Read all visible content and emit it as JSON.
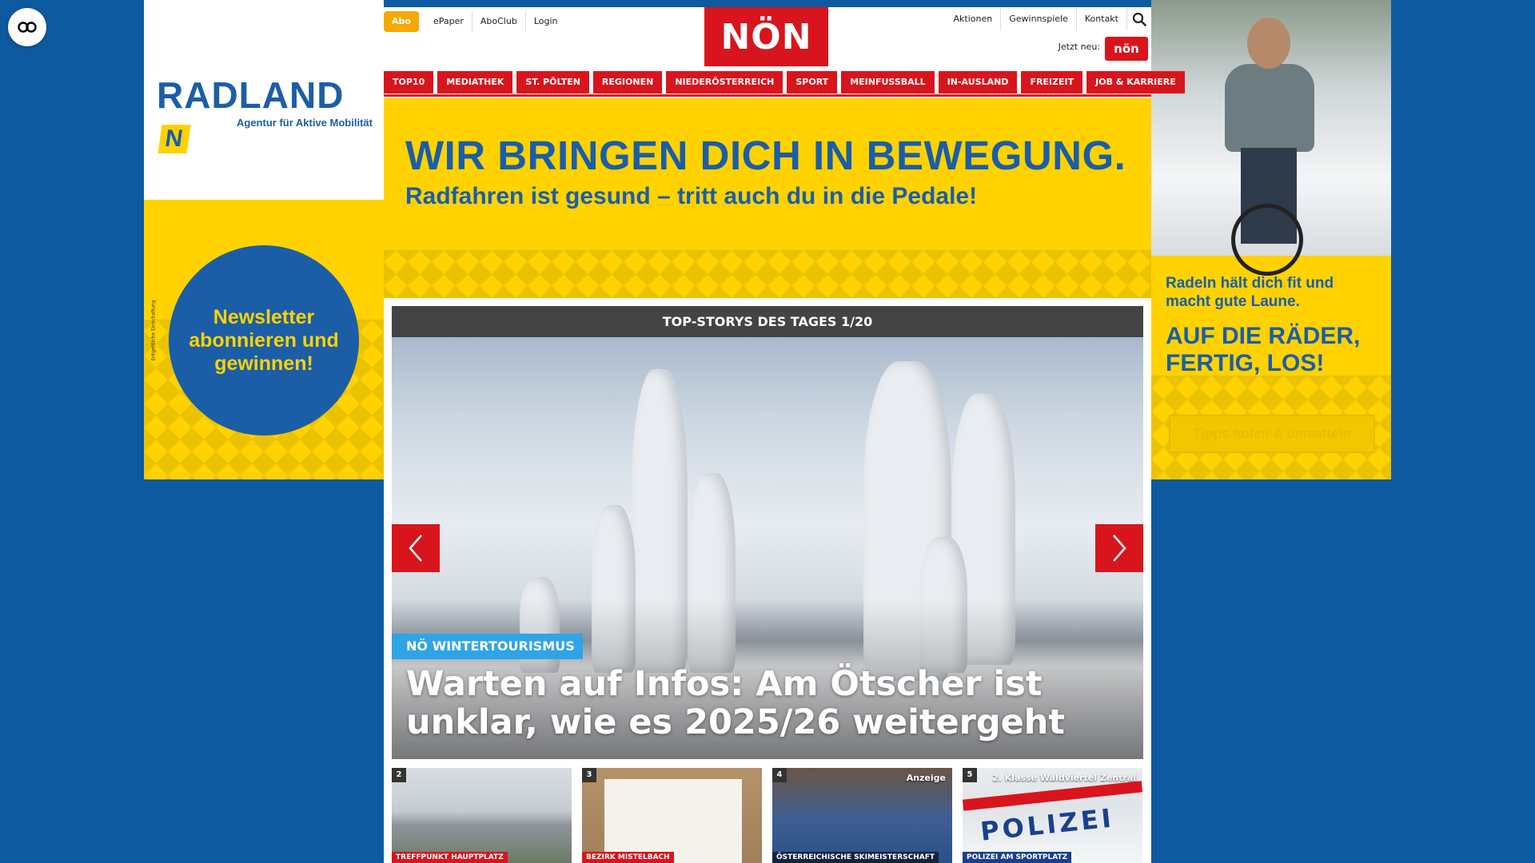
{
  "left_ad": {
    "logo_main": "RADLAND",
    "logo_n": "N",
    "logo_sub": "Agentur für Aktive Mobilität",
    "newsletter": "Newsletter abonnieren und gewinnen!",
    "vertical_note": "Entgeltliche Einschaltung"
  },
  "right_ad": {
    "text_small": "Radeln hält dich fit und macht gute Laune.",
    "text_big": "AUF DIE RÄDER, FERTIG, LOS!",
    "button": "Tipps holen & umsatteln"
  },
  "header": {
    "abo": "Abo",
    "util_left": [
      "ePaper",
      "AboClub",
      "Login"
    ],
    "logo": "NÖN",
    "util_right": [
      "Aktionen",
      "Gewinnspiele",
      "Kontakt"
    ],
    "jetzt_neu": "Jetzt neu:",
    "mini_logo": "nön"
  },
  "nav": [
    "TOP10",
    "MEDIATHEK",
    "ST. PÖLTEN",
    "REGIONEN",
    "NIEDERÖSTERREICH",
    "SPORT",
    "MEINFUSSBALL",
    "IN-AUSLAND",
    "FREIZEIT",
    "JOB & KARRIERE"
  ],
  "banner": {
    "headline": "WIR BRINGEN DICH IN BEWEGUNG.",
    "subline": "Radfahren ist gesund – tritt auch du in die Pedale!"
  },
  "top_stories": {
    "header": "TOP-STORYS DES TAGES 1/20",
    "kicker": "NÖ WINTERTOURISMUS",
    "title": "Warten auf Infos: Am Ötscher ist unklar, wie es 2025/26 weitergeht"
  },
  "teasers": [
    {
      "num": "2",
      "badge": "",
      "kicker": "TREFFPUNKT HAUPTPLATZ"
    },
    {
      "num": "3",
      "badge": "",
      "kicker": "BEZIRK MISTELBACH"
    },
    {
      "num": "4",
      "badge": "Anzeige",
      "kicker": "ÖSTERREICHISCHE SKIMEISTERSCHAFT"
    },
    {
      "num": "5",
      "badge": "2. Klasse Waldviertel Zentral",
      "kicker": "POLIZEI AM SPORTPLATZ"
    }
  ],
  "teaser_4_image_text": "POLIZEI",
  "colors": {
    "page_bg": "#0e5aa0",
    "noen_red": "#d8151c",
    "ad_yellow": "#ffd200",
    "ad_blue": "#1b5ea7",
    "abo_orange": "#f5a800",
    "kicker_blue": "#2fa4e7"
  },
  "icons": [
    "accessibility-icon",
    "search-icon",
    "chevron-left-icon",
    "chevron-right-icon"
  ]
}
